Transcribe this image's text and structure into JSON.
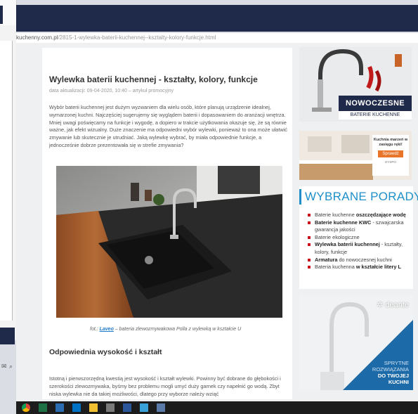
{
  "browser": {
    "url_domain": "kuchenny.com.pl",
    "url_path": "/2815-1-wylewka-baterii-kuchennej--ksztalty-kolory-funkcje.html"
  },
  "article": {
    "title": "Wylewka baterii kuchennej - kształty, kolory, funkcje",
    "meta": "data aktualizacji: 09-04-2020, 10:40 – artykuł promocyjny",
    "intro": "Wybór baterii kuchennej jest dużym wyzwaniem dla wielu osób, które planują urządzenie idealnej, wymarzonej kuchni. Najczęściej sugerujemy się wyglądem baterii i dopasowaniem do aranżacji wnętrza. Mniej uwagi poświęcamy na funkcje i wygodę, a dopiero w trakcie użytkowania okazuje się, że są równie ważne, jak efekt wizualny. Duże znaczenie ma odpowiedni wybór wylewki, ponieważ to ona może ułatwić zmywanie lub skutecznie je utrudniać. Jaką wylewkę wybrać, by miała odpowiednie funkcje, a jednocześnie dobrze prezentowała się w strefie zmywania?",
    "caption_prefix": "fot.: ",
    "caption_link": "Laveo",
    "caption_rest": " – bateria zlewozmywakowa Polla z wylewką w kształcie U",
    "section_heading": "Odpowiednia wysokość i kształt",
    "section_para": "Istotną i pierwszorzędną kwestią jest wysokość i kształt wylewki. Powinny być dobrane do głębokości i szerokości zlewozmywaka, byśmy bez problemu mogli umyć duży garnek czy napełnić go wodą. Zbyt niska wylewka nie da takiej możliwości, dlatego przy wyborze należy wziąć"
  },
  "sidebar": {
    "ad1": {
      "line1": "NOWOCZESNE",
      "line2": "BATERIE KUCHENNE"
    },
    "ad2": {
      "text": "Kuchnia marzeń w zasięgu ręki!",
      "button": "Sprawdź",
      "brand": "DYSPO"
    },
    "tips_title": "WYBRANE PORADY",
    "tips": [
      {
        "pre": "Baterie kuchenne ",
        "bold": "oszczędzające wodę",
        "post": ""
      },
      {
        "pre": "",
        "bold": "Baterie kuchenne KWC",
        "post": " - szwajcarska gwarancja jakości"
      },
      {
        "pre": "Baterie ekologiczne",
        "bold": "",
        "post": ""
      },
      {
        "pre": "",
        "bold": "Wylewka baterii kuchennej",
        "post": " - kształty, kolory, funkcje"
      },
      {
        "pre": "",
        "bold": "Armatura",
        "post": " do nowoczesnej kuchni"
      },
      {
        "pre": "Bateria kuchenna ",
        "bold": "w kształcie litery L",
        "post": ""
      }
    ],
    "ad3": {
      "brand": "deante",
      "line1": "SPRYTNE",
      "line2": "ROZWIĄZANIA",
      "line3": "DO TWOJEJ",
      "line4": "KUCHNI"
    }
  },
  "colors": {
    "dark_navy": "#1f2a4a",
    "accent_blue": "#1f8fc9",
    "bullet_red": "#c8101c",
    "ad_blue": "#1d6aa8"
  },
  "taskbar": {
    "icons": [
      "chrome-icon",
      "excel-icon",
      "app-icon",
      "outlook-icon",
      "explorer-icon",
      "app-icon",
      "word-icon",
      "photos-icon",
      "app-icon"
    ]
  }
}
